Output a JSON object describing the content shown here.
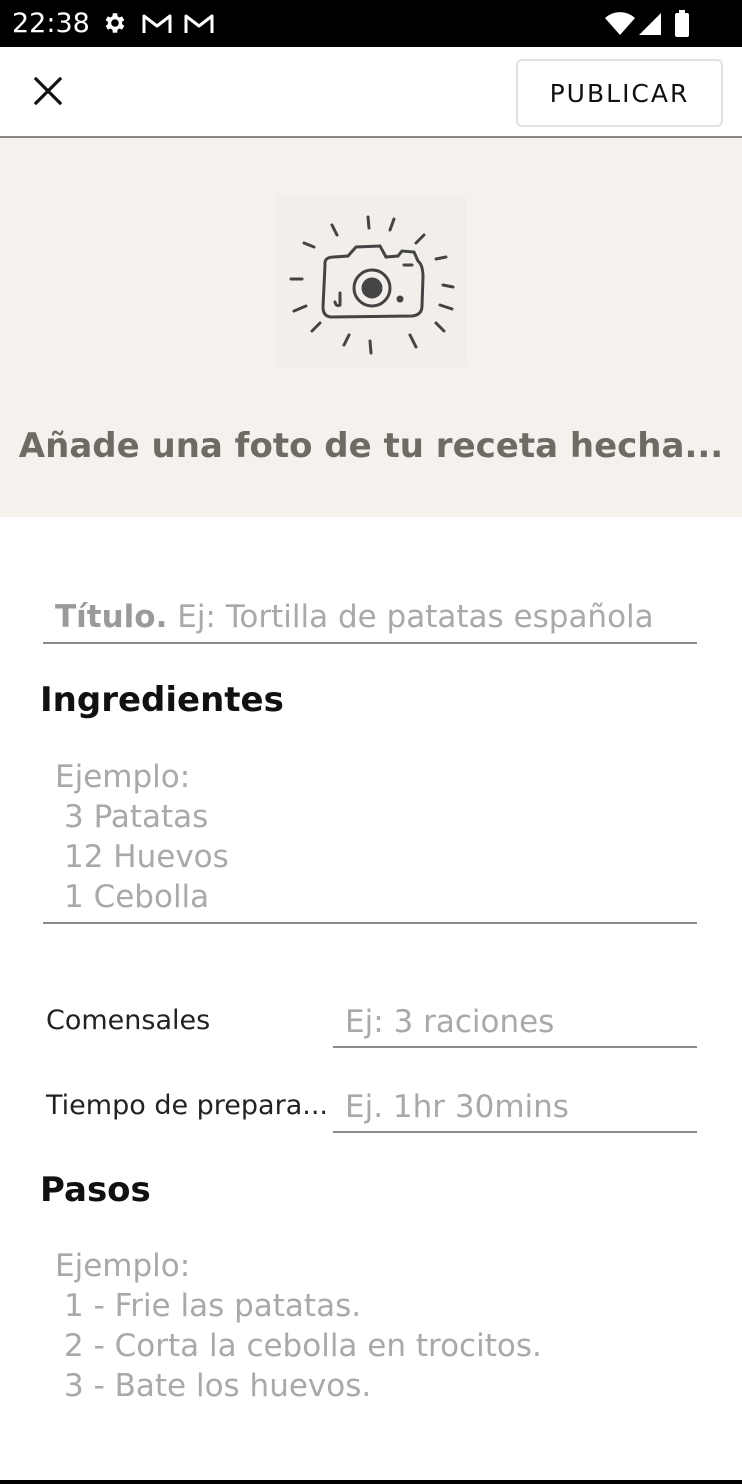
{
  "status_bar": {
    "time": "22:38",
    "icons": [
      "settings-icon",
      "gmail-icon",
      "gmail-icon",
      "wifi-icon",
      "signal-icon",
      "battery-icon"
    ]
  },
  "app_bar": {
    "close_icon": "close-icon",
    "publish_label": "PUBLICAR"
  },
  "photo": {
    "icon": "camera-icon",
    "label": "Añade una foto de tu receta hecha..."
  },
  "title_field": {
    "bold_prefix": "Título.",
    "placeholder": " Ej: Tortilla de patatas española"
  },
  "ingredients": {
    "heading": "Ingredientes",
    "placeholder_lines": [
      "Ejemplo:",
      "3 Patatas",
      "12 Huevos",
      "1 Cebolla"
    ]
  },
  "servings": {
    "label": "Comensales",
    "placeholder": "Ej: 3 raciones"
  },
  "prep_time": {
    "label": "Tiempo de prepara...",
    "placeholder": "Ej. 1hr 30mins"
  },
  "steps": {
    "heading": "Pasos",
    "placeholder_lines": [
      "Ejemplo:",
      "1 - Frie las patatas.",
      "2 - Corta la cebolla en trocitos.",
      "3 - Bate los huevos."
    ]
  },
  "colors": {
    "photo_background": "#f5f2ee",
    "placeholder_text": "#a9a9a9",
    "photo_text": "#6f6a64"
  }
}
